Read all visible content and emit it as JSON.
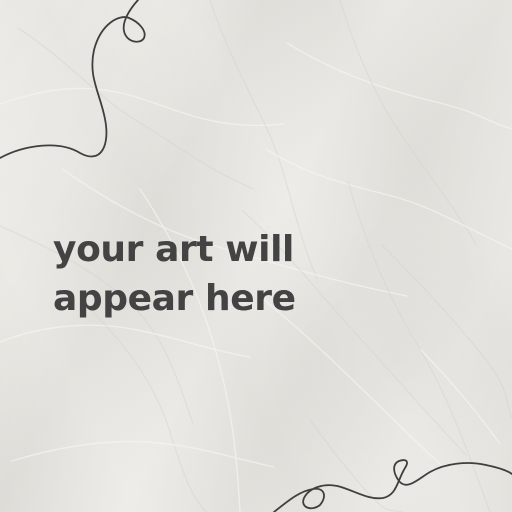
{
  "canvas": {
    "background_color": "#e9e7e2",
    "texture_line_color": "#d7d3cd",
    "texture_highlight_color": "#f6f4f0",
    "ink_color": "#3f3f3f",
    "text_color": "#434343"
  },
  "headline": {
    "lines": [
      "your art will",
      "appear here"
    ]
  }
}
